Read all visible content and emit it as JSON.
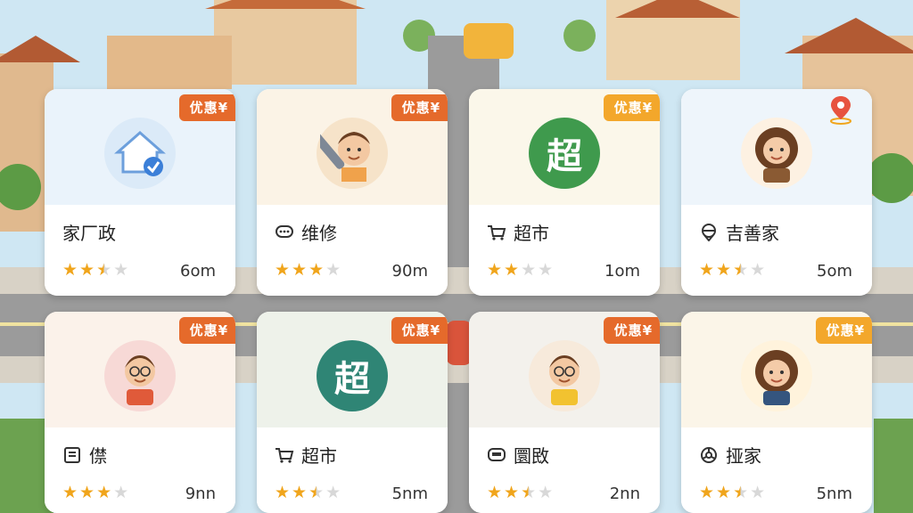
{
  "colors": {
    "badge_orange": "#e56a2b",
    "badge_yellow": "#f3a72b",
    "star": "#f0a51c",
    "super_green": "#3f9a4d",
    "super_teal": "#2f8575"
  },
  "cards": [
    {
      "badge": "优惠¥",
      "title": "家厂政",
      "distance": "6om",
      "rating": 2.5,
      "icon": "house-check-icon",
      "title_icon": "none"
    },
    {
      "badge": "优惠¥",
      "title": "维修",
      "distance": "90m",
      "rating": 3,
      "icon": "repairman-avatar",
      "title_icon": "chat-bubble-icon"
    },
    {
      "badge": "优惠¥",
      "title": "超市",
      "distance": "1om",
      "rating": 2,
      "icon": "supermarket-badge",
      "super": "超",
      "title_icon": "cart-icon"
    },
    {
      "badge": "",
      "title": "吉善家",
      "distance": "5om",
      "rating": 2.5,
      "icon": "woman-avatar",
      "title_icon": "location-pin-icon"
    },
    {
      "badge": "优惠¥",
      "title": "僸",
      "distance": "9nn",
      "rating": 2.5,
      "icon": "man-avatar",
      "title_icon": "menu-box-icon"
    },
    {
      "badge": "优惠¥",
      "title": "超市",
      "distance": "5nm",
      "rating": 2.5,
      "icon": "supermarket-badge",
      "super": "超",
      "title_icon": "cart-icon"
    },
    {
      "badge": "优惠¥",
      "title": "圜敃",
      "distance": "2nn",
      "rating": 2.5,
      "icon": "man-avatar",
      "title_icon": "bus-icon"
    },
    {
      "badge": "优惠¥",
      "title": "挜家",
      "distance": "5nm",
      "rating": 2.5,
      "icon": "woman-avatar",
      "title_icon": "wheel-icon"
    }
  ]
}
